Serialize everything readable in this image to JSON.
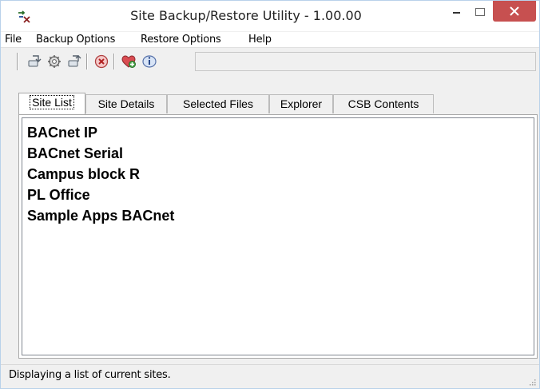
{
  "window": {
    "title": "Site Backup/Restore Utility - 1.00.00"
  },
  "menu": [
    {
      "label": "File"
    },
    {
      "label": "Backup Options"
    },
    {
      "label": "Restore Options"
    },
    {
      "label": "Help"
    }
  ],
  "toolbar": {
    "icons": [
      "backup-site-icon",
      "settings-icon",
      "restore-site-icon",
      "stop-icon",
      "add-site-icon",
      "info-icon"
    ]
  },
  "tabs": [
    {
      "label": "Site List",
      "active": true
    },
    {
      "label": "Site Details",
      "active": false
    },
    {
      "label": "Selected Files",
      "active": false
    },
    {
      "label": "Explorer",
      "active": false
    },
    {
      "label": "CSB Contents",
      "active": false
    }
  ],
  "sites": [
    "BACnet IP",
    "BACnet Serial",
    "Campus block R",
    "PL Office",
    "Sample Apps BACnet"
  ],
  "status": {
    "text": "Displaying a list of current sites."
  },
  "colors": {
    "close_button": "#c75050",
    "window_bg": "#f0f0f0",
    "list_bg": "#ffffff"
  }
}
